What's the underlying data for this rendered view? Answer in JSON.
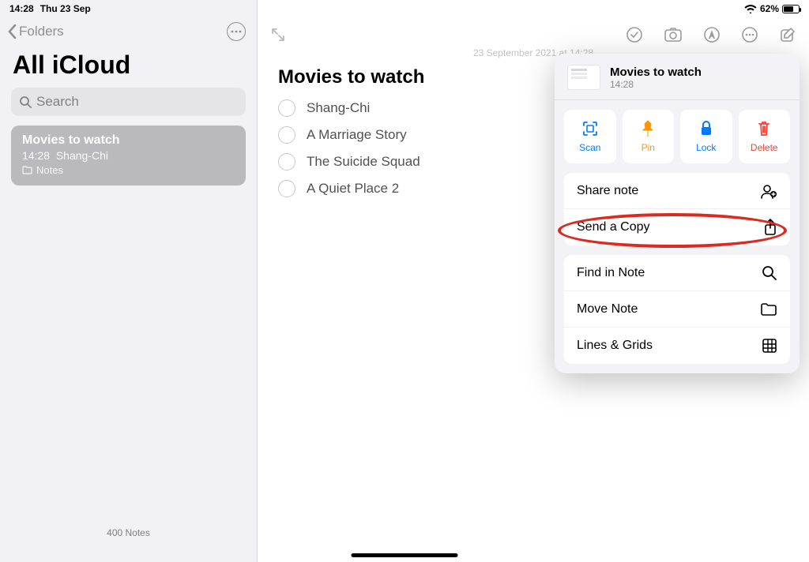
{
  "status": {
    "time": "14:28",
    "date": "Thu 23 Sep",
    "battery": "62%"
  },
  "sidebar": {
    "back_label": "Folders",
    "title": "All iCloud",
    "search_placeholder": "Search",
    "note": {
      "title": "Movies to watch",
      "time": "14:28",
      "preview": "Shang-Chi",
      "folder": "Notes"
    },
    "footer": "400 Notes"
  },
  "note": {
    "date": "23 September 2021 at 14:28",
    "title": "Movies to watch",
    "items": [
      "Shang-Chi",
      "A Marriage Story",
      "The Suicide Squad",
      "A Quiet Place 2"
    ]
  },
  "popover": {
    "title": "Movies to watch",
    "time": "14:28",
    "actions": {
      "scan": "Scan",
      "pin": "Pin",
      "lock": "Lock",
      "delete": "Delete"
    },
    "rows": {
      "share": "Share note",
      "send": "Send a Copy",
      "find": "Find in Note",
      "move": "Move Note",
      "lines": "Lines & Grids"
    }
  }
}
